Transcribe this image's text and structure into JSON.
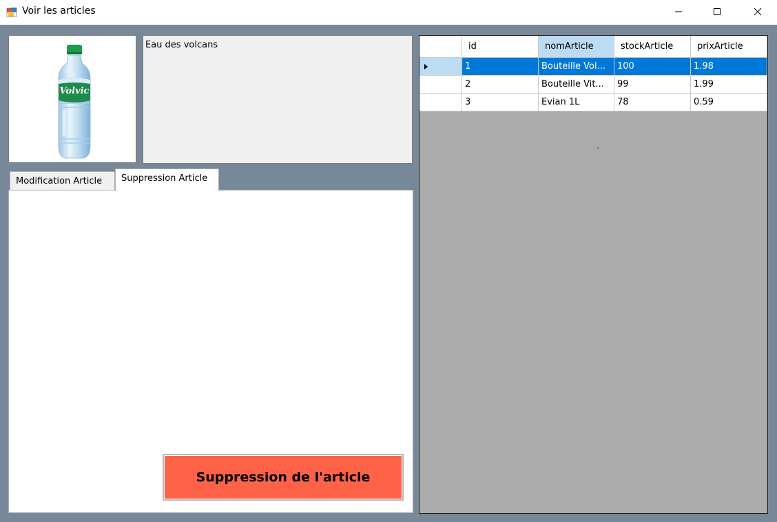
{
  "window": {
    "title": "Voir les articles",
    "app_icon": "winforms-app-icon",
    "controls": [
      "minimize-icon",
      "maximize-icon",
      "close-icon"
    ]
  },
  "image": {
    "alt_icon": "water-bottle-image",
    "label": "Volvic"
  },
  "description": {
    "text": "Eau des volcans"
  },
  "tabs": [
    {
      "label": "Modification Article",
      "selected": false
    },
    {
      "label": "Suppression Article",
      "selected": true
    }
  ],
  "actions": {
    "delete_label": "Suppression de l'article",
    "delete_color": "#ff6347"
  },
  "grid": {
    "columns": [
      "id",
      "nomArticle",
      "stockArticle",
      "prixArticle"
    ],
    "selected_column": "nomArticle",
    "rows": [
      {
        "id": "1",
        "nomArticle": "Bouteille Vol...",
        "stockArticle": "100",
        "prixArticle": "1.98"
      },
      {
        "id": "2",
        "nomArticle": "Bouteille Vit...",
        "stockArticle": "99",
        "prixArticle": "1.99"
      },
      {
        "id": "3",
        "nomArticle": "Evian 1L",
        "stockArticle": "78",
        "prixArticle": "0.59"
      }
    ],
    "selected_row": 0,
    "selection_color": "#0078d7",
    "background_color": "#ababab"
  },
  "colors": {
    "form_background": "#778899"
  }
}
